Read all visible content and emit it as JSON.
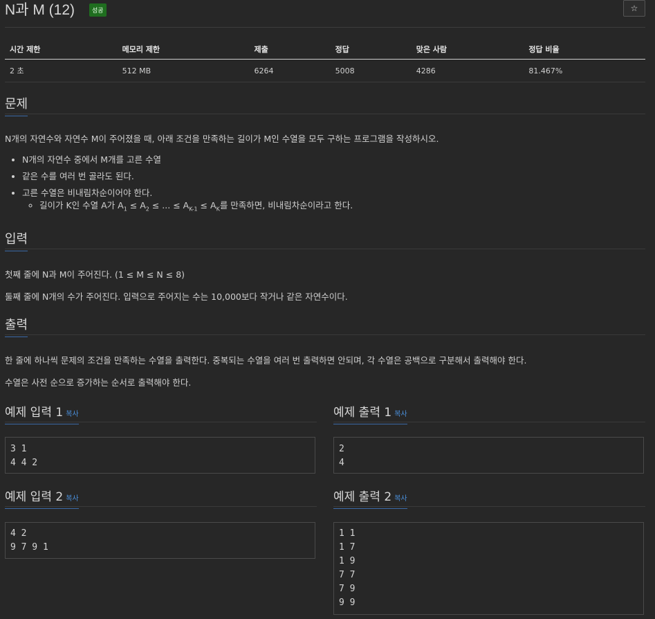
{
  "problem": {
    "title": "N과 M (12)",
    "status_badge": "성공",
    "star_icon": "☆"
  },
  "info_table": {
    "headers": [
      "시간 제한",
      "메모리 제한",
      "제출",
      "정답",
      "맞은 사람",
      "정답 비율"
    ],
    "values": [
      "2 초",
      "512 MB",
      "6264",
      "5008",
      "4286",
      "81.467%"
    ]
  },
  "description": {
    "heading": "문제",
    "text": "N개의 자연수와 자연수 M이 주어졌을 때, 아래 조건을 만족하는 길이가 M인 수열을 모두 구하는 프로그램을 작성하시오.",
    "items": [
      "N개의 자연수 중에서 M개를 고른 수열",
      "같은 수를 여러 번 골라도 된다.",
      "고른 수열은 비내림차순이어야 한다."
    ],
    "subitem": {
      "prefix": "길이가 K인 수열 A가 A",
      "mid1": " ≤ A",
      "mid2": " ≤ ... ≤ A",
      "mid3": " ≤ A",
      "suffix": "를 만족하면, 비내림차순이라고 한다.",
      "sub1": "1",
      "sub2": "2",
      "sub3": "K-1",
      "sub4": "K"
    }
  },
  "input": {
    "heading": "입력",
    "line1": "첫째 줄에 N과 M이 주어진다. (1 ≤ M ≤ N ≤ 8)",
    "line2": "둘째 줄에 N개의 수가 주어진다. 입력으로 주어지는 수는 10,000보다 작거나 같은 자연수이다."
  },
  "output": {
    "heading": "출력",
    "line1": "한 줄에 하나씩 문제의 조건을 만족하는 수열을 출력한다. 중복되는 수열을 여러 번 출력하면 안되며, 각 수열은 공백으로 구분해서 출력해야 한다.",
    "line2": "수열은 사전 순으로 증가하는 순서로 출력해야 한다."
  },
  "samples": {
    "copy_label": "복사",
    "input1": {
      "title": "예제 입력 1",
      "lines": [
        "3 1",
        "4 4 2"
      ]
    },
    "output1": {
      "title": "예제 출력 1",
      "lines": [
        "2",
        "4"
      ]
    },
    "input2": {
      "title": "예제 입력 2",
      "lines": [
        "4 2",
        "9 7 9 1"
      ]
    },
    "output2": {
      "title": "예제 출력 2",
      "lines": [
        "1 1",
        "1 7",
        "1 9",
        "7 7",
        "7 9",
        "9 9"
      ]
    }
  }
}
